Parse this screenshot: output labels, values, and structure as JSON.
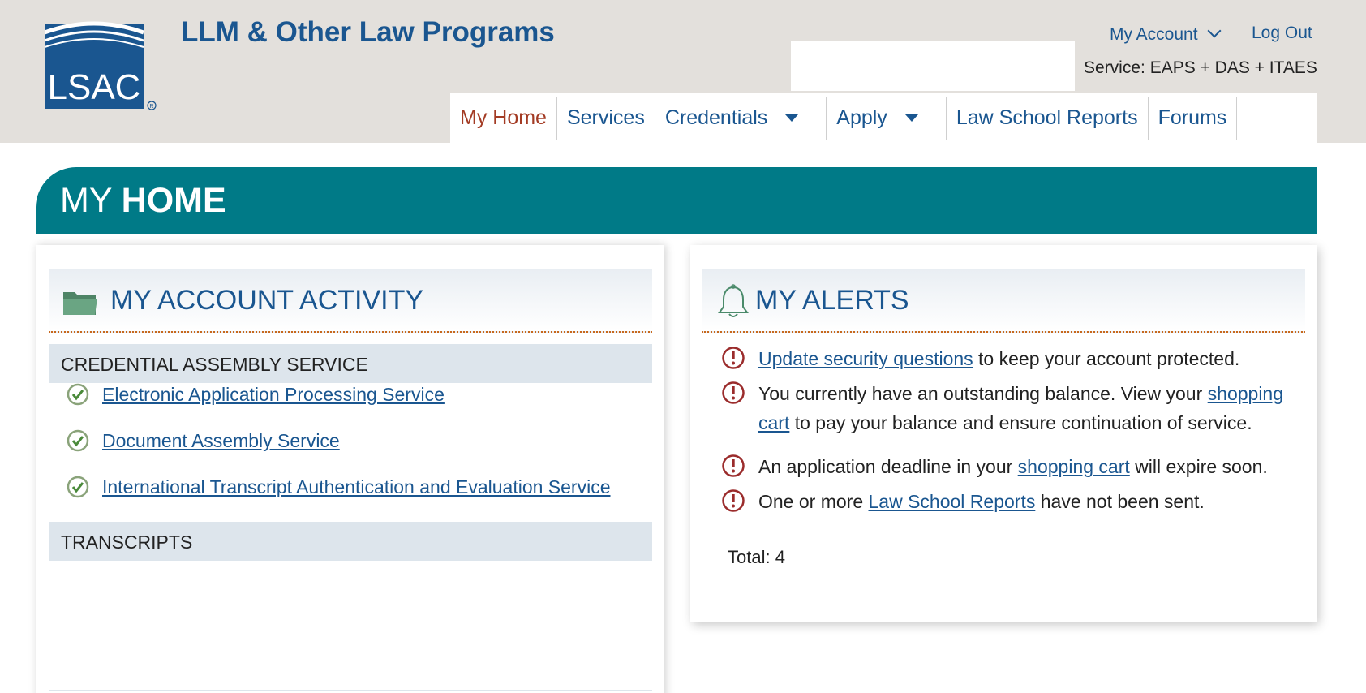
{
  "header": {
    "logo_text": "LSAC",
    "site_title": "LLM & Other Law Programs",
    "my_account": "My Account",
    "log_out": "Log Out",
    "service_line": "Service: EAPS + DAS + ITAES"
  },
  "nav": {
    "items": [
      {
        "label": "My Home",
        "active": true
      },
      {
        "label": "Services"
      },
      {
        "label": "Credentials",
        "dropdown": true
      },
      {
        "label": "Apply",
        "dropdown": true
      },
      {
        "label": "Law School Reports"
      },
      {
        "label": "Forums"
      }
    ]
  },
  "banner": {
    "prefix": "MY ",
    "bold": "HOME"
  },
  "account_activity": {
    "title": "MY ACCOUNT ACTIVITY",
    "icon": "folder-icon",
    "section1": "CREDENTIAL ASSEMBLY SERVICE",
    "services": [
      "Electronic Application Processing Service",
      "Document Assembly Service",
      "International Transcript Authentication and Evaluation Service"
    ],
    "section2": "TRANSCRIPTS"
  },
  "alerts": {
    "title": "MY ALERTS",
    "icon": "bell-icon",
    "a1": {
      "link": "Update security questions",
      "after": " to keep your account protected."
    },
    "a2": {
      "before": "You currently have an outstanding balance. View your ",
      "link": "shopping cart",
      "after": " to pay your balance and ensure continuation of service."
    },
    "a3": {
      "before": "An application deadline in your ",
      "link": "shopping cart",
      "after": " will expire soon."
    },
    "a4": {
      "before": "One or more ",
      "link": "Law School Reports",
      "after": " have not been sent."
    },
    "total": "Total: 4"
  },
  "colors": {
    "brand_blue": "#1a5690",
    "teal_banner": "#007a87",
    "active_nav": "#a33b24",
    "alert_red": "#9b2c2c",
    "check_green": "#4a8a3a"
  }
}
